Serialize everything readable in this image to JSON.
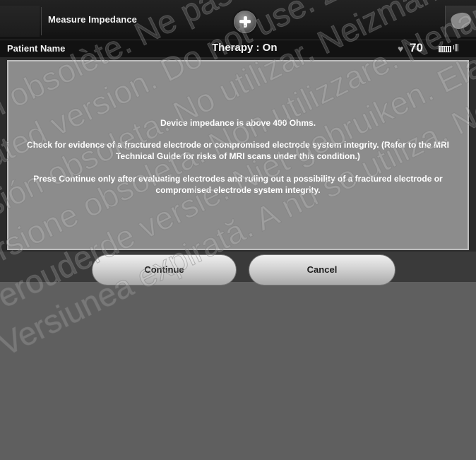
{
  "window": {
    "title": "Measure Impedance"
  },
  "statusbar": {
    "patient_label": "Patient Name",
    "therapy": "Therapy : On",
    "heart_rate": "70"
  },
  "dialog": {
    "line1": "Device impedance is above 400 Ohms.",
    "line2": "Check for evidence of a fractured electrode or compromised electrode system integrity. (Refer to the MRI Technical Guide for risks of MRI scans under this condition.)",
    "line3": "Press Continue only after evaluating electrodes and ruling out a possibility of a fractured electrode or compromised electrode system integrity."
  },
  "buttons": {
    "continue_label": "Continue",
    "cancel_label": "Cancel"
  },
  "icons": {
    "add": "plus-icon",
    "menu": "hand-icon",
    "heart": "heart-icon",
    "battery": "battery-icon",
    "signal": "signal-icon"
  },
  "watermark": {
    "lines": [
      "Version obsolète. Ne pas utiliser.",
      "Outdated version. Do not use. Zastaralá verze",
      "Versión obsoleta. No utilizar. Neizmantot.",
      "Versione obsoleta. Non utilizzare. Nenaudokite.",
      "Verouderde versie. Niet gebruiken. Elavult verzió.",
      "Versiunea expirată. A nu se utiliza. Ne használja!"
    ]
  }
}
